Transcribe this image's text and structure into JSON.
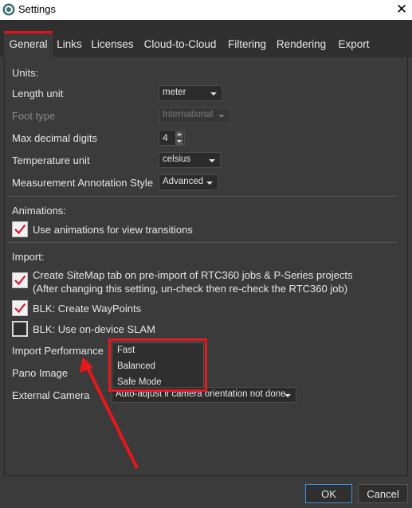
{
  "window": {
    "title": "Settings",
    "close_glyph": "✕"
  },
  "tabs": [
    {
      "label": "General",
      "active": true
    },
    {
      "label": "Links"
    },
    {
      "label": "Licenses"
    },
    {
      "label": "Cloud-to-Cloud"
    },
    {
      "label": "Filtering"
    },
    {
      "label": "Rendering"
    },
    {
      "label": "Export"
    }
  ],
  "units": {
    "heading": "Units:",
    "length_unit": {
      "label": "Length unit",
      "value": "meter"
    },
    "foot_type": {
      "label": "Foot type",
      "value": "International"
    },
    "max_decimal_digits": {
      "label": "Max decimal digits",
      "value": "4"
    },
    "temperature_unit": {
      "label": "Temperature unit",
      "value": "celsius"
    },
    "measurement_annotation_style": {
      "label": "Measurement Annotation Style",
      "value": "Advanced"
    }
  },
  "animations": {
    "heading": "Animations:",
    "use_animations": {
      "label": "Use animations for view transitions",
      "checked": true
    }
  },
  "import": {
    "heading": "Import:",
    "sitemap_tab": {
      "label_line1": "Create SiteMap tab on pre-import of RTC360 jobs & P-Series projects",
      "label_line2": "(After changing this setting, un-check then re-check the RTC360 job)",
      "checked": true
    },
    "blk_waypoints": {
      "label": "BLK: Create WayPoints",
      "checked": true
    },
    "blk_slam": {
      "label": "BLK: Use on-device SLAM",
      "checked": false
    },
    "import_performance": {
      "label": "Import Performance",
      "options": [
        "Fast",
        "Balanced",
        "Safe Mode"
      ]
    },
    "pano_image": {
      "label": "Pano Image"
    },
    "external_camera": {
      "label": "External Camera",
      "value": "Auto-adjust if camera orientation not done"
    }
  },
  "buttons": {
    "ok": "OK",
    "cancel": "Cancel"
  },
  "colors": {
    "accent": "#e0141e",
    "annotation": "#e8171b",
    "focus": "#3d8fd6"
  }
}
